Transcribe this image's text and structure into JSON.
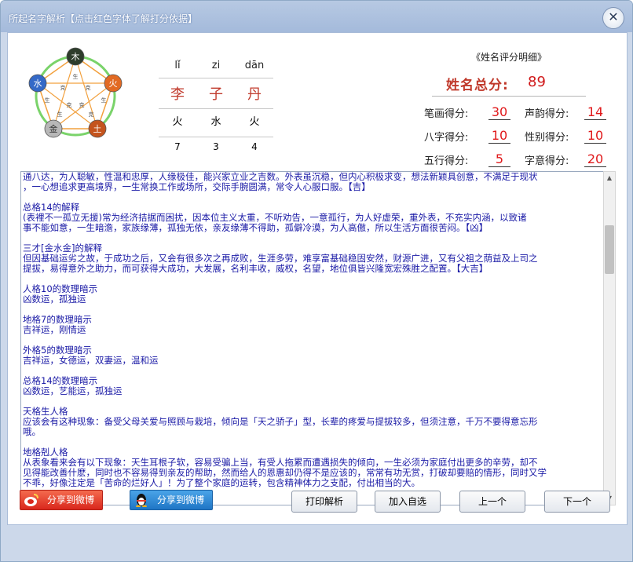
{
  "window": {
    "title": "所起名字解析【点击红色字体了解打分依据】",
    "close_symbol": "✕"
  },
  "wuxing": {
    "nodes": [
      {
        "label": "木",
        "color": "#2e3d2b"
      },
      {
        "label": "火",
        "color": "#e26a23"
      },
      {
        "label": "土",
        "color": "#c4541e"
      },
      {
        "label": "金",
        "color": "#b7b7b7"
      },
      {
        "label": "水",
        "color": "#3469c7"
      }
    ],
    "inner_labels": [
      "生",
      "克",
      "克",
      "克",
      "克",
      "克",
      "生",
      "生",
      "生"
    ]
  },
  "name": {
    "pinyin": [
      "lǐ",
      "zi",
      "dān"
    ],
    "chars": [
      "李",
      "子",
      "丹"
    ],
    "elements": [
      "火",
      "水",
      "火"
    ],
    "strokes": [
      "7",
      "3",
      "4"
    ]
  },
  "scores": {
    "title": "《姓名评分明细》",
    "total_label": "姓名总分:",
    "total_value": "89",
    "items": [
      {
        "label": "笔画得分:",
        "value": "30"
      },
      {
        "label": "声韵得分:",
        "value": "14"
      },
      {
        "label": "八字得分:",
        "value": "10"
      },
      {
        "label": "性别得分:",
        "value": "10"
      },
      {
        "label": "五行得分:",
        "value": "5"
      },
      {
        "label": "字意得分:",
        "value": "20"
      }
    ]
  },
  "analysis": {
    "lines": [
      "通八达，为人聪敏，性温和忠厚，人缘极佳，能兴家立业之吉数。外表虽沉稳，但内心积极求变，想法新颖具创意，不满足于现状",
      "，一心想追求更高境界，一生常换工作或场所，交际手腕圆满，常令人心服口服。【吉】",
      "",
      "总格14的解释",
      "(表裡不一孤立无援)常为经济拮据而困扰，因本位主义太重，不听劝告，一意孤行，为人好虚荣，重外表，不充实内涵，以致诸",
      "事不能如意，一生暗澹，家族缘薄，孤独无依，亲友缘薄不得助，孤僻冷漠，为人高傲，所以生活方面很苦闷。【凶】",
      "",
      "三才[金水金]的解释",
      "但因基础运劣之故，于成功之后，又会有很多次之再成败，生涯多劳，难享富基础稳固安然，财源广进，又有父祖之荫益及上司之",
      "提拔，易得意外之助力，而可获得大成功，大发展，名利丰收，威权，名望，地位俱皆兴隆宽宏殊胜之配置。【大吉】",
      "",
      "人格10的数理暗示",
      "凶数运，孤独运",
      "",
      "地格7的数理暗示",
      "吉祥运，刚情运",
      "",
      "外格5的数理暗示",
      "吉祥运，女德运，双妻运，温和运",
      "",
      "总格14的数理暗示",
      "凶数运，艺能运，孤独运",
      "",
      "天格生人格",
      "应该会有这种现象：备受父母关爱与照顾与栽培，倾向是「天之骄子」型，长辈的疼爱与提拔较多，但须注意，千万不要得意忘形",
      "哦。",
      "",
      "地格剋人格",
      "从表象看来会有以下现象：天生耳根子软，容易受骗上当，有受人拖累而遭遇损失的倾向，一生必须为家庭付出更多的辛劳，却不",
      "见得能改善什麽，同时也不容易得到亲友的帮助，然而给人的恩惠却仍得不是应该的，常常有功无赏，打破却要赔的情形，同时又学",
      "不乖，好像注定是「苦命的烂好人」！为了整个家庭的运转，包含精神体力之支配，付出相当的大。"
    ]
  },
  "buttons": {
    "share_weibo": "分享到微博",
    "share_qq_weibo": "分享到微博",
    "print": "打印解析",
    "add_favorite": "加入自选",
    "prev": "上一个",
    "next": "下一个"
  },
  "colors": {
    "accent_red": "#d0191a",
    "text_blue": "#1a1aa6",
    "title_bar": "#a4badb"
  }
}
